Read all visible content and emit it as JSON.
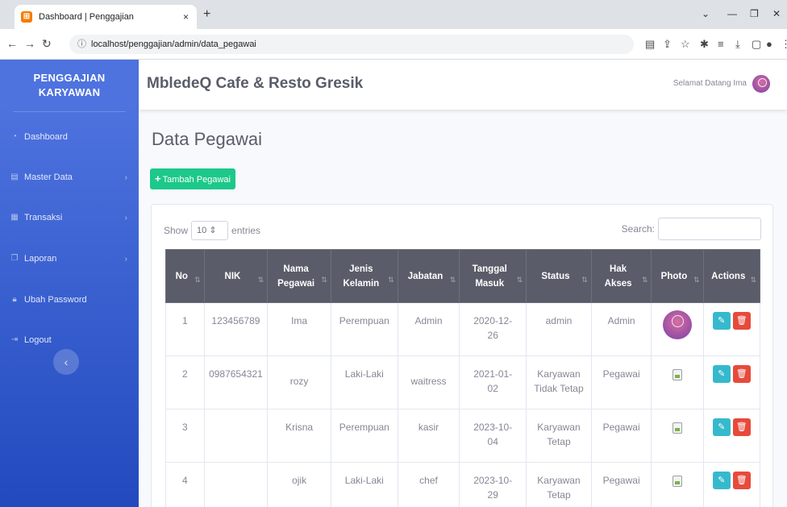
{
  "browser": {
    "tab_title": "Dashboard | Penggajian",
    "tab_close": "×",
    "new_tab": "+",
    "url": "localhost/penggajian/admin/data_pegawai"
  },
  "sidebar": {
    "brand_line1": "PENGGAJIAN",
    "brand_line2": "KARYAWAN",
    "items": [
      {
        "label": "Dashboard",
        "icon": "dashboard-icon"
      },
      {
        "label": "Master Data",
        "icon": "database-icon",
        "has_submenu": true
      },
      {
        "label": "Transaksi",
        "icon": "table-icon",
        "has_submenu": true
      },
      {
        "label": "Laporan",
        "icon": "copy-icon",
        "has_submenu": true
      },
      {
        "label": "Ubah Password",
        "icon": "lock-icon"
      },
      {
        "label": "Logout",
        "icon": "logout-icon"
      }
    ]
  },
  "topbar": {
    "title": "MbledeQ Cafe & Resto Gresik",
    "greeting": "Selamat Datang Ima"
  },
  "page": {
    "title": "Data Pegawai",
    "add_button": "Tambah Pegawai"
  },
  "table_controls": {
    "show_label": "Show",
    "entries_value": "10",
    "entries_label": "entries",
    "search_label": "Search:"
  },
  "table": {
    "headers": [
      {
        "line1": "No",
        "line2": ""
      },
      {
        "line1": "NIK",
        "line2": ""
      },
      {
        "line1": "Nama",
        "line2": "Pegawai"
      },
      {
        "line1": "Jenis",
        "line2": "Kelamin"
      },
      {
        "line1": "Jabatan",
        "line2": ""
      },
      {
        "line1": "Tanggal",
        "line2": "Masuk"
      },
      {
        "line1": "Status",
        "line2": ""
      },
      {
        "line1": "Hak",
        "line2": "Akses"
      },
      {
        "line1": "Photo",
        "line2": ""
      },
      {
        "line1": "Actions",
        "line2": ""
      }
    ],
    "rows": [
      {
        "no": "1",
        "nik": "123456789",
        "nama": "Ima",
        "jk": "Perempuan",
        "jabatan": "Admin",
        "tgl1": "2020-12-",
        "tgl2": "26",
        "status1": "admin",
        "status2": "",
        "akses": "Admin",
        "photo": "avatar"
      },
      {
        "no": "2",
        "nik": "0987654321",
        "nama": "rozy",
        "jk": "Laki-Laki",
        "jabatan": "waitress",
        "tgl1": "2021-01-",
        "tgl2": "02",
        "status1": "Karyawan",
        "status2": "Tidak Tetap",
        "akses": "Pegawai",
        "photo": "broken"
      },
      {
        "no": "3",
        "nik": "",
        "nama": "Krisna",
        "jk": "Perempuan",
        "jabatan": "kasir",
        "tgl1": "2023-10-",
        "tgl2": "04",
        "status1": "Karyawan",
        "status2": "Tetap",
        "akses": "Pegawai",
        "photo": "broken"
      },
      {
        "no": "4",
        "nik": "",
        "nama": "ojik",
        "jk": "Laki-Laki",
        "jabatan": "chef",
        "tgl1": "2023-10-",
        "tgl2": "29",
        "status1": "Karyawan",
        "status2": "Tetap",
        "akses": "Pegawai",
        "photo": "broken"
      }
    ]
  },
  "colors": {
    "sidebar": "#4e73df",
    "add_button": "#1cc88a",
    "edit_button": "#36b9cc",
    "delete_button": "#e74a3b",
    "table_header": "#5a5c69"
  }
}
